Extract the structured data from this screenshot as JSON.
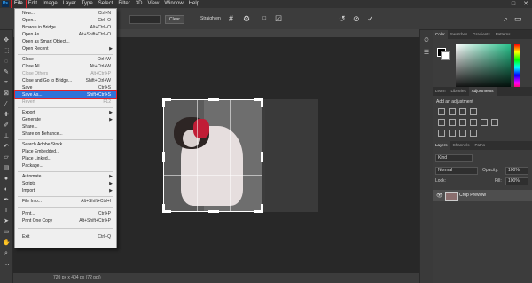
{
  "app": {
    "logo": "Ps"
  },
  "menubar": {
    "items": [
      "File",
      "Edit",
      "Image",
      "Layer",
      "Type",
      "Select",
      "Filter",
      "3D",
      "View",
      "Window",
      "Help"
    ],
    "window_controls": [
      "–",
      "□",
      "✕"
    ]
  },
  "options": {
    "clear_label": "Clear",
    "straighten_label": "Straighten"
  },
  "file_menu": {
    "items": [
      {
        "label": "New...",
        "shortcut": "Ctrl+N"
      },
      {
        "label": "Open...",
        "shortcut": "Ctrl+O"
      },
      {
        "label": "Browse in Bridge...",
        "shortcut": "Alt+Ctrl+O"
      },
      {
        "label": "Open As...",
        "shortcut": "Alt+Shift+Ctrl+O"
      },
      {
        "label": "Open as Smart Object...",
        "shortcut": ""
      },
      {
        "label": "Open Recent",
        "shortcut": ""
      },
      {
        "label": "Close",
        "shortcut": "Ctrl+W"
      },
      {
        "label": "Close All",
        "shortcut": "Alt+Ctrl+W"
      },
      {
        "label": "Close Others",
        "shortcut": "Alt+Ctrl+P"
      },
      {
        "label": "Close and Go to Bridge...",
        "shortcut": "Shift+Ctrl+W"
      },
      {
        "label": "Save",
        "shortcut": "Ctrl+S"
      },
      {
        "label": "Save As...",
        "shortcut": "Shift+Ctrl+S"
      },
      {
        "label": "Revert",
        "shortcut": "F12"
      },
      {
        "label": "Export",
        "shortcut": ""
      },
      {
        "label": "Generate",
        "shortcut": ""
      },
      {
        "label": "Share...",
        "shortcut": ""
      },
      {
        "label": "Share on Behance...",
        "shortcut": ""
      },
      {
        "label": "Search Adobe Stock...",
        "shortcut": ""
      },
      {
        "label": "Place Embedded...",
        "shortcut": ""
      },
      {
        "label": "Place Linked...",
        "shortcut": ""
      },
      {
        "label": "Package...",
        "shortcut": ""
      },
      {
        "label": "Automate",
        "shortcut": ""
      },
      {
        "label": "Scripts",
        "shortcut": ""
      },
      {
        "label": "Import",
        "shortcut": ""
      },
      {
        "label": "File Info...",
        "shortcut": "Alt+Shift+Ctrl+I"
      },
      {
        "label": "Print...",
        "shortcut": "Ctrl+P"
      },
      {
        "label": "Print One Copy",
        "shortcut": "Alt+Shift+Ctrl+P"
      },
      {
        "label": "Exit",
        "shortcut": "Ctrl+Q"
      }
    ]
  },
  "status": {
    "text": "720 px x 404 px (72 ppi)"
  },
  "panels": {
    "color_tabs": [
      "Color",
      "Swatches",
      "Gradients",
      "Patterns"
    ],
    "adj_tabs": [
      "Learn",
      "Libraries",
      "Adjustments"
    ],
    "adj_title": "Add an adjustment",
    "layer_tabs": [
      "Layers",
      "Channels",
      "Paths"
    ],
    "kind_label": "Kind",
    "blend_mode": "Normal",
    "opacity_label": "Opacity:",
    "opacity_value": "100%",
    "lock_label": "Lock:",
    "fill_label": "Fill:",
    "fill_value": "100%",
    "layer_name": "Crop Preview"
  }
}
